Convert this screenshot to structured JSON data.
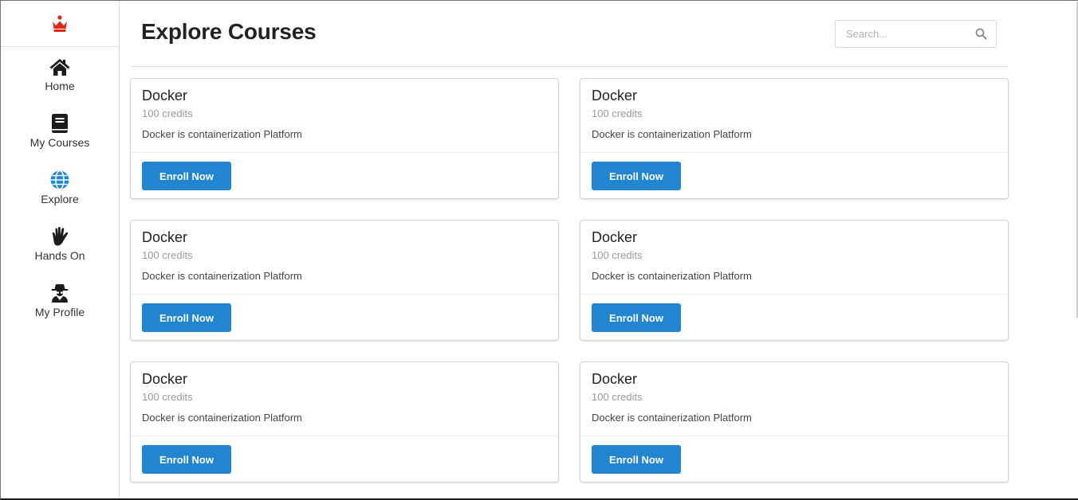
{
  "brand": {
    "logo_icon": "crown-icon",
    "logo_color": "#e0251b"
  },
  "sidebar": {
    "items": [
      {
        "label": "Home",
        "icon": "home-icon"
      },
      {
        "label": "My Courses",
        "icon": "book-icon"
      },
      {
        "label": "Explore",
        "icon": "globe-icon"
      },
      {
        "label": "Hands On",
        "icon": "hand-icon"
      },
      {
        "label": "My Profile",
        "icon": "user-secret-icon"
      }
    ]
  },
  "header": {
    "title": "Explore Courses"
  },
  "search": {
    "placeholder": "Search...",
    "value": "",
    "icon": "search-icon"
  },
  "courses": [
    {
      "title": "Docker",
      "credits": "100 credits",
      "description": "Docker is containerization Platform",
      "button": "Enroll Now"
    },
    {
      "title": "Docker",
      "credits": "100 credits",
      "description": "Docker is containerization Platform",
      "button": "Enroll Now"
    },
    {
      "title": "Docker",
      "credits": "100 credits",
      "description": "Docker is containerization Platform",
      "button": "Enroll Now"
    },
    {
      "title": "Docker",
      "credits": "100 credits",
      "description": "Docker is containerization Platform",
      "button": "Enroll Now"
    },
    {
      "title": "Docker",
      "credits": "100 credits",
      "description": "Docker is containerization Platform",
      "button": "Enroll Now"
    },
    {
      "title": "Docker",
      "credits": "100 credits",
      "description": "Docker is containerization Platform",
      "button": "Enroll Now"
    }
  ],
  "colors": {
    "accent": "#2185d0",
    "explore_icon": "#2185d0",
    "text": "#222222"
  }
}
